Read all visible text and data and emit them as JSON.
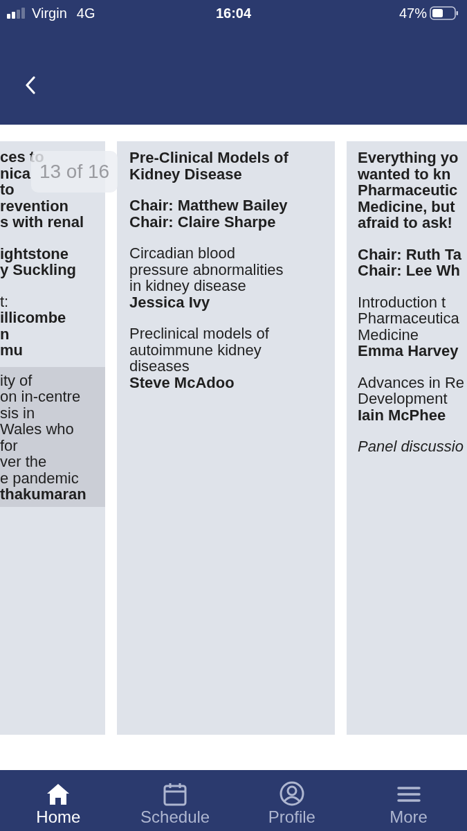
{
  "status_bar": {
    "carrier": "Virgin",
    "network": "4G",
    "time": "16:04",
    "battery": "47%"
  },
  "pager": "13 of 16",
  "cards": [
    {
      "sections": [
        {
          "kind": "title",
          "highlighted": false,
          "lines": [
            "ces to",
            "nica",
            "to",
            "revention",
            "s with renal"
          ]
        },
        {
          "kind": "chairs",
          "highlighted": false,
          "lines": [
            "ightstone",
            "y Suckling"
          ]
        },
        {
          "kind": "talk",
          "highlighted": false,
          "lines": [
            "t:"
          ],
          "speakers": [
            "illicombe",
            "n",
            "mu"
          ]
        },
        {
          "kind": "talk",
          "highlighted": true,
          "lines": [
            "ity of",
            "on in-centre",
            "sis in",
            "Wales who",
            "for",
            "ver the",
            "e pandemic"
          ],
          "speakers": [
            "thakumaran"
          ]
        }
      ]
    },
    {
      "sections": [
        {
          "kind": "title",
          "highlighted": false,
          "lines": [
            "Pre-Clinical Models of",
            "Kidney Disease"
          ]
        },
        {
          "kind": "chairs",
          "highlighted": false,
          "lines": [
            "Chair: Matthew Bailey",
            "Chair: Claire Sharpe"
          ]
        },
        {
          "kind": "talk",
          "highlighted": false,
          "lines": [
            "Circadian blood",
            "pressure abnormalities",
            "in kidney disease"
          ],
          "speakers": [
            "Jessica Ivy"
          ]
        },
        {
          "kind": "talk",
          "highlighted": false,
          "lines": [
            "Preclinical models of",
            "autoimmune kidney",
            "diseases"
          ],
          "speakers": [
            "Steve McAdoo"
          ]
        }
      ]
    },
    {
      "sections": [
        {
          "kind": "title",
          "highlighted": false,
          "lines": [
            "Everything yo",
            "wanted to kn",
            "Pharmaceutic",
            "Medicine, but",
            "afraid to ask!"
          ]
        },
        {
          "kind": "chairs",
          "highlighted": false,
          "lines": [
            "Chair: Ruth Ta",
            "Chair: Lee Wh"
          ]
        },
        {
          "kind": "talk",
          "highlighted": false,
          "lines": [
            "Introduction t",
            "Pharmaceutica",
            "Medicine"
          ],
          "speakers": [
            "Emma Harvey"
          ]
        },
        {
          "kind": "talk",
          "highlighted": false,
          "lines": [
            "Advances in Re",
            "Development"
          ],
          "speakers": [
            "Iain McPhee"
          ]
        },
        {
          "kind": "note",
          "highlighted": false,
          "lines": [
            "Panel discussio"
          ]
        }
      ]
    }
  ],
  "tabs": [
    {
      "label": "Home",
      "kind": "home",
      "selected": true
    },
    {
      "label": "Schedule",
      "kind": "calendar",
      "selected": false
    },
    {
      "label": "Profile",
      "kind": "profile",
      "selected": false
    },
    {
      "label": "More",
      "kind": "menu",
      "selected": false
    }
  ]
}
